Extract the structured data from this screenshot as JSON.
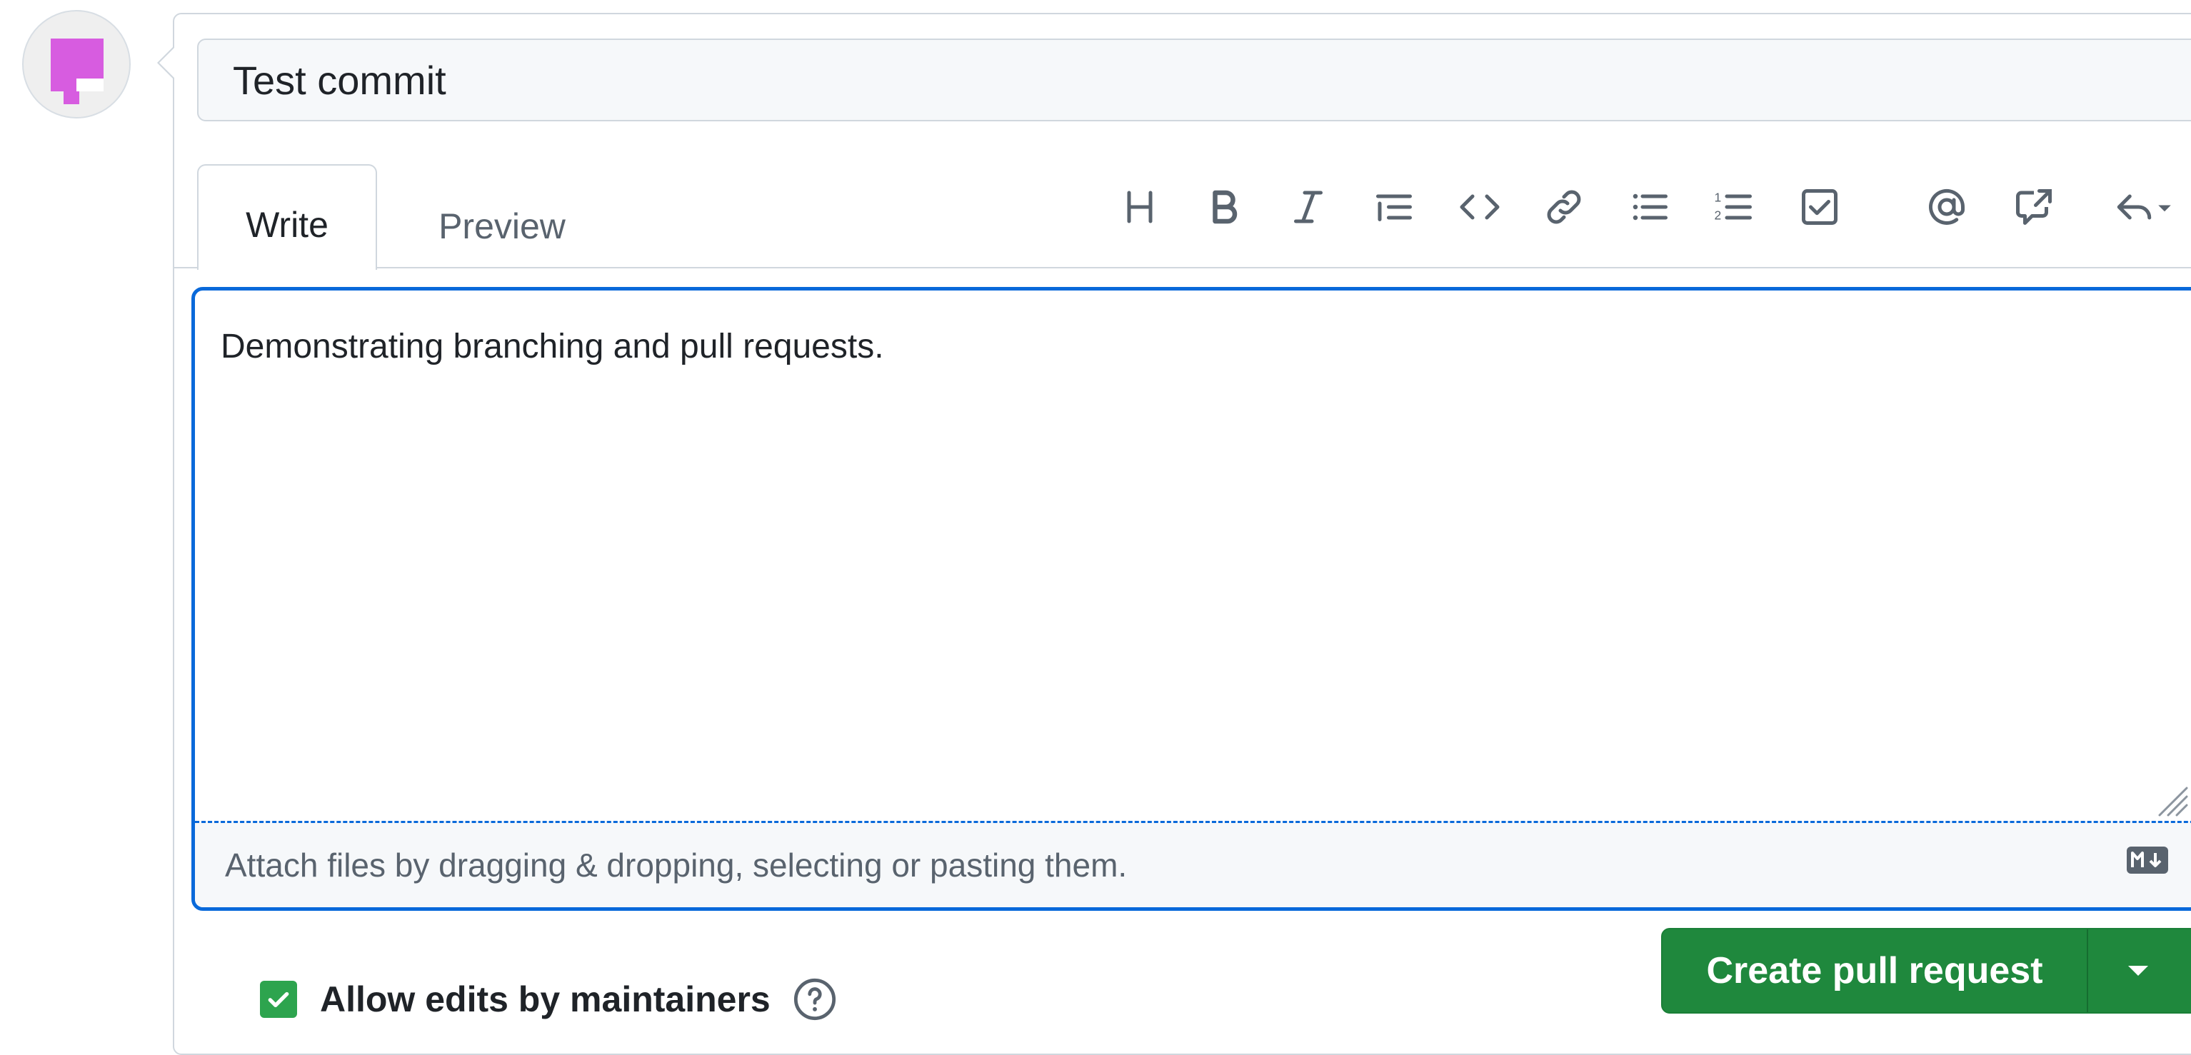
{
  "title_input": {
    "value": "Test commit"
  },
  "tabs": [
    {
      "label": "Write",
      "active": true
    },
    {
      "label": "Preview",
      "active": false
    }
  ],
  "toolbar": {
    "icons": [
      "heading-icon",
      "bold-icon",
      "italic-icon",
      "quote-icon",
      "code-icon",
      "link-icon",
      "unordered-list-icon",
      "ordered-list-icon",
      "task-list-icon",
      "mention-icon",
      "cross-reference-icon",
      "reply-icon"
    ]
  },
  "editor": {
    "body": "Demonstrating branching and pull requests.",
    "attach_hint": "Attach files by dragging & dropping, selecting or pasting them."
  },
  "allow_edits": {
    "label": "Allow edits by maintainers",
    "checked": true
  },
  "create_button": {
    "label": "Create pull request"
  },
  "colors": {
    "accent": "#0969da",
    "primary_button": "#1f883d",
    "avatar": "#d75ce0"
  }
}
